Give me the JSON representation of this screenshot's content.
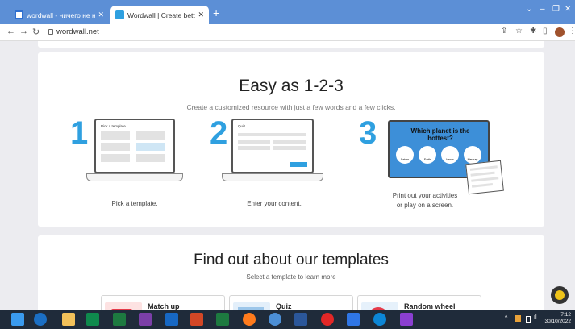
{
  "browser": {
    "tabs": [
      {
        "title": "wordwall - ничего не найдено.",
        "active": false
      },
      {
        "title": "Wordwall | Create better lessons",
        "active": true
      }
    ],
    "new_tab": "+",
    "url": "wordwall.net"
  },
  "easy": {
    "title": "Easy as 1-2-3",
    "subtitle": "Create a customized resource with just a few words and a few clicks.",
    "steps": [
      {
        "number": "1",
        "label": "Pick a template."
      },
      {
        "number": "2",
        "label": "Enter your content."
      },
      {
        "number": "3",
        "label_line1": "Print out your activities",
        "label_line2": "or play on a screen."
      }
    ],
    "screen3_text": "Which planet is the hottest?",
    "screen3_answers": [
      "Saturn",
      "Earth",
      "Venus",
      "Mercury"
    ],
    "screen1_text": "Pick a template",
    "screen2_text": "Quiz"
  },
  "templates": {
    "title": "Find out about our templates",
    "subtitle": "Select a template to learn more",
    "items": [
      {
        "label": "Match up"
      },
      {
        "label": "Quiz"
      },
      {
        "label": "Random wheel"
      }
    ]
  },
  "taskbar": {
    "time": "7:12",
    "date": "30/10/2022"
  },
  "colors": {
    "brand_blue": "#2fa0e0",
    "tab_strip": "#5c8fd6",
    "taskbar": "#1f2b3a"
  }
}
